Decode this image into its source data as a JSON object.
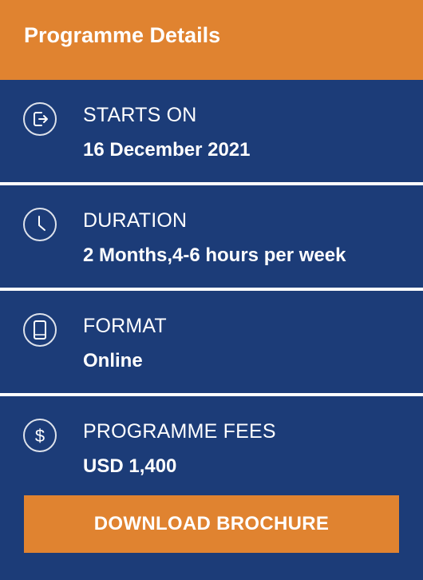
{
  "header": {
    "title": "Programme Details"
  },
  "details": [
    {
      "icon": "exit-icon",
      "label": "STARTS ON",
      "value": "16 December 2021"
    },
    {
      "icon": "clock-icon",
      "label": "DURATION",
      "value": "2 Months,4-6 hours per week"
    },
    {
      "icon": "tablet-icon",
      "label": "FORMAT",
      "value": "Online"
    },
    {
      "icon": "dollar-icon",
      "label": "PROGRAMME FEES",
      "value": "USD 1,400"
    }
  ],
  "cta": {
    "label": "DOWNLOAD BROCHURE"
  },
  "colors": {
    "accent": "#e08330",
    "panel": "#1c3c78",
    "text": "#ffffff"
  }
}
